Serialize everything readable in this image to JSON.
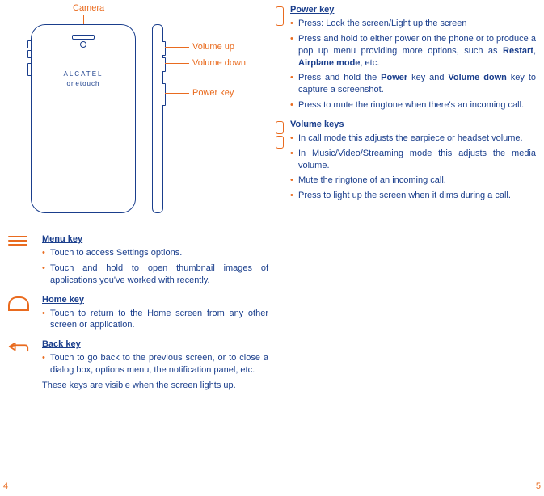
{
  "diagram": {
    "camera_label": "Camera",
    "volume_up_label": "Volume up",
    "volume_down_label": "Volume down",
    "power_key_label": "Power key",
    "logo_line1": "ALCATEL",
    "logo_line2": "onetouch"
  },
  "left_keys": {
    "menu": {
      "heading": "Menu key",
      "bullets": [
        "Touch to access Settings options.",
        "Touch and hold to open thumbnail images of applications you've worked with recently."
      ]
    },
    "home": {
      "heading": "Home key",
      "bullets": [
        "Touch to return to the Home screen from any other screen or application."
      ]
    },
    "back": {
      "heading": "Back key",
      "bullets": [
        "Touch to go back to the previous screen, or to close a dialog box, options menu, the notification panel, etc."
      ]
    },
    "note": "These keys are visible when the screen lights up."
  },
  "right_keys": {
    "power": {
      "heading": "Power key",
      "bullets": [
        "Press: Lock the screen/Light up the screen",
        "Press and hold to either power on the phone or to produce a pop up menu providing more options, such as <b>Restart</b>, <b>Airplane mode</b>, etc.",
        "Press and hold the <b>Power</b> key and <b>Volume down</b> key to capture a screenshot.",
        "Press to mute the ringtone when there's an incoming call."
      ]
    },
    "volume": {
      "heading": "Volume keys",
      "bullets": [
        "In call mode this adjusts the earpiece or headset volume.",
        "In Music/Video/Streaming mode this adjusts the media volume.",
        "Mute the ringtone of an incoming call.",
        "Press to light up the screen when it dims during a call."
      ]
    }
  },
  "page_numbers": {
    "left": "4",
    "right": "5"
  }
}
